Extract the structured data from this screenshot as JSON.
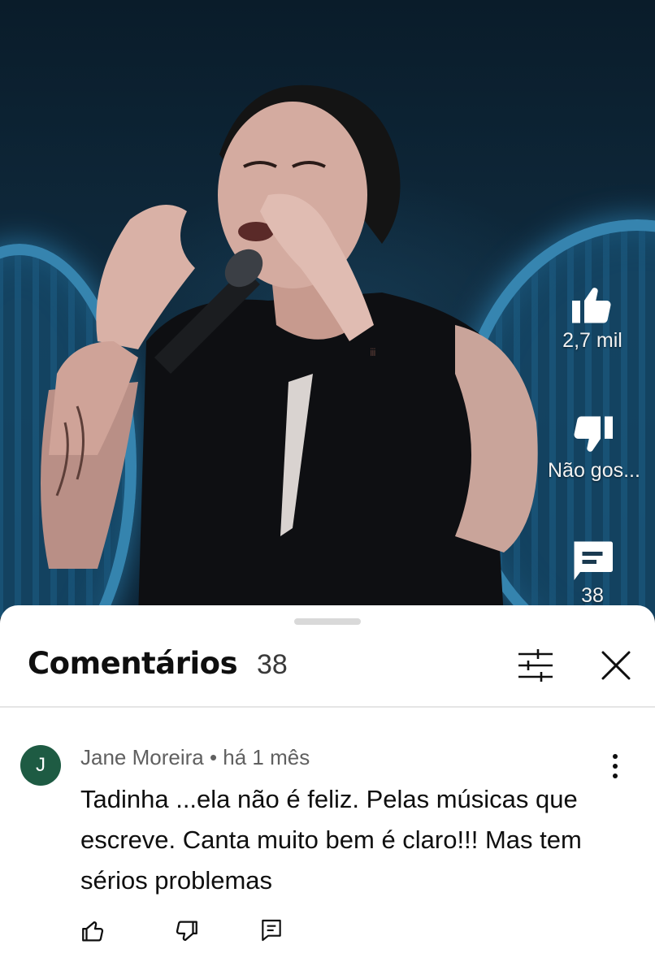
{
  "video": {
    "like_count": "2,7 mil",
    "dislike_label": "Não gos...",
    "comments_count_partial": "38"
  },
  "comments_sheet": {
    "title": "Comentários",
    "count": "38",
    "comments": [
      {
        "avatar_initial": "J",
        "avatar_color": "#1e5b43",
        "meta": "Jane Moreira • há 1 mês",
        "text": "Tadinha ...ela não é feliz. Pelas músicas que escreve. Canta muito bem é claro!!! Mas tem sérios problemas"
      }
    ]
  },
  "icons": {
    "like": "thumbs-up-icon",
    "dislike": "thumbs-down-icon",
    "comments": "comment-icon",
    "filter": "filter-sliders-icon",
    "close": "close-icon",
    "more": "more-vertical-icon",
    "reply": "reply-icon"
  }
}
